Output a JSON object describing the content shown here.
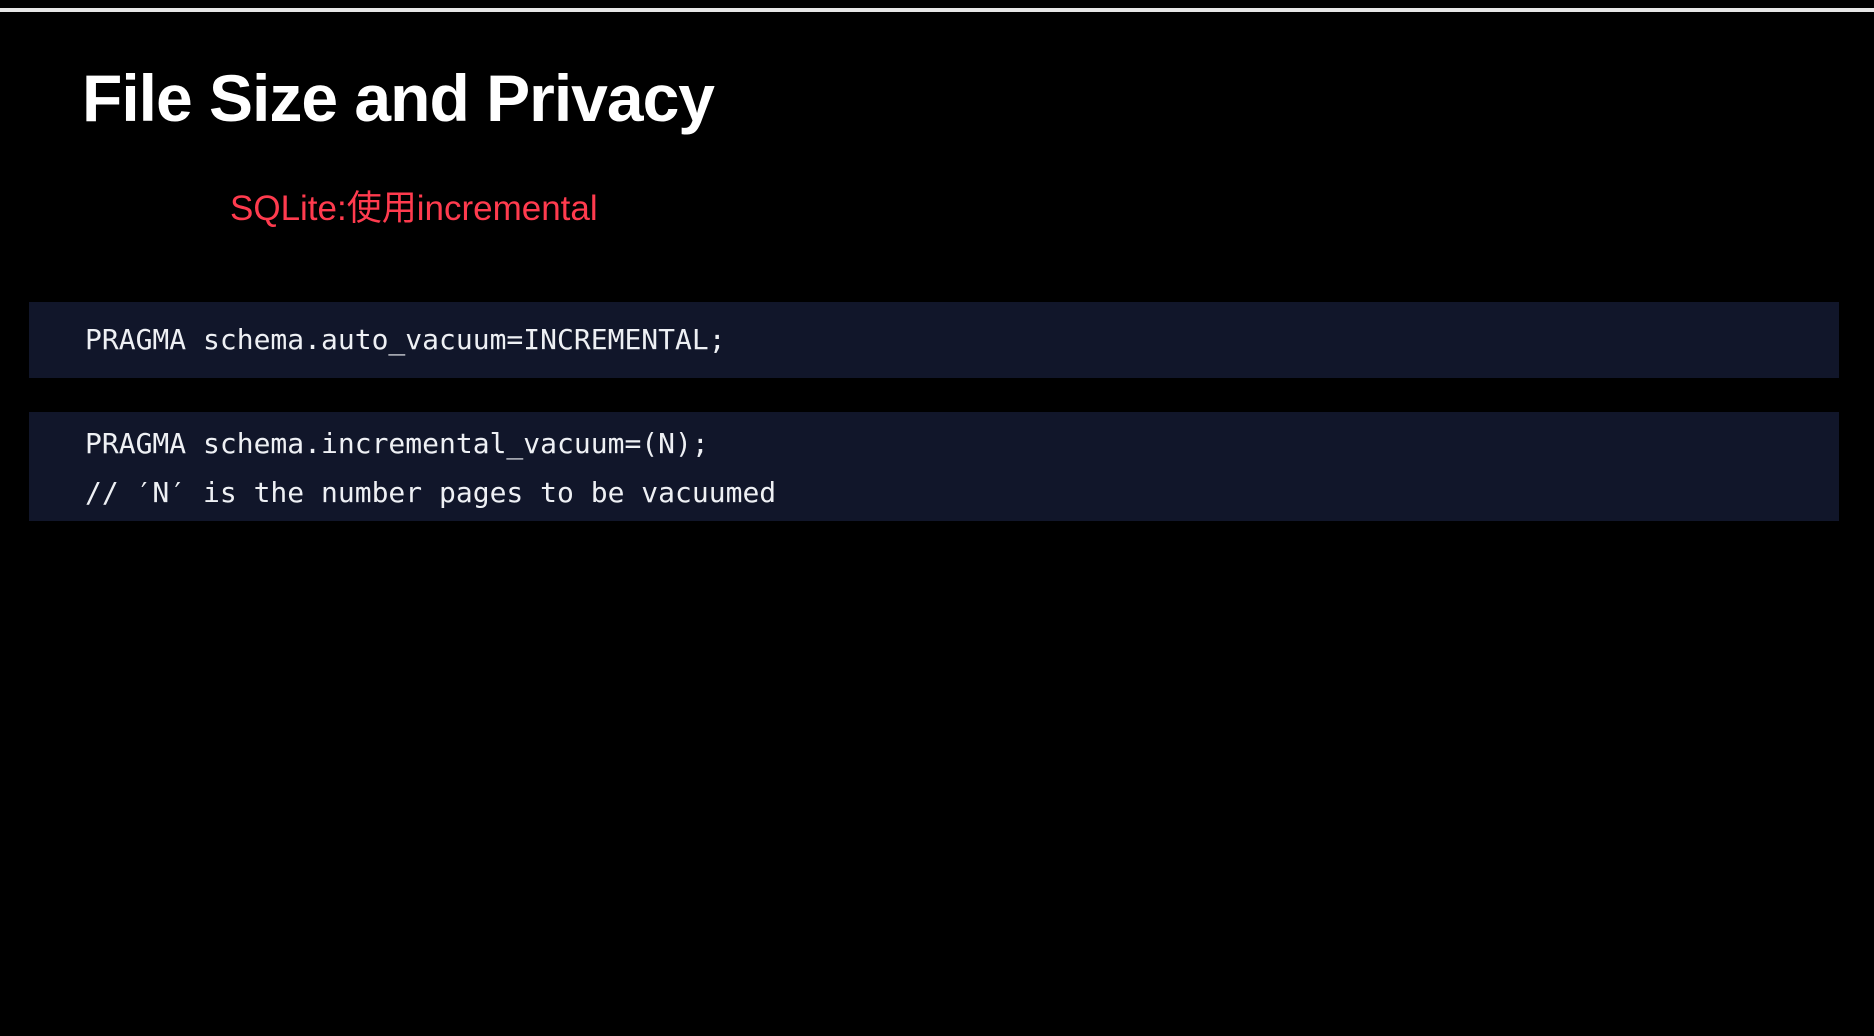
{
  "slide": {
    "title": "File Size and Privacy",
    "subtitle": "SQLite:使用incremental"
  },
  "code_blocks": [
    {
      "lines": [
        "PRAGMA schema.auto_vacuum=INCREMENTAL;"
      ]
    },
    {
      "lines": [
        "PRAGMA schema.incremental_vacuum=(N);",
        "// ′N′ is the number pages to be vacuumed"
      ]
    }
  ],
  "colors": {
    "background": "#000000",
    "title": "#ffffff",
    "subtitle": "#ff3b4e",
    "code_background": "#11162a",
    "code_text": "#eef0f4",
    "top_rule": "#e6e6e6"
  }
}
